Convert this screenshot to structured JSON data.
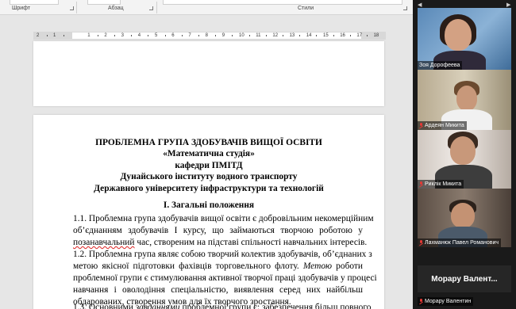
{
  "ribbon": {
    "groups": [
      {
        "label": "Шрифт"
      },
      {
        "label": "Абзац"
      },
      {
        "label": "Стили"
      }
    ]
  },
  "ruler": {
    "numbers": [
      "2",
      "1",
      "1",
      "2",
      "3",
      "4",
      "5",
      "6",
      "7",
      "8",
      "9",
      "10",
      "11",
      "12",
      "13",
      "14",
      "15",
      "16",
      "17",
      "18"
    ]
  },
  "document": {
    "title_lines": [
      "ПРОБЛЕМНА ГРУПА ЗДОБУВАЧІВ ВИЩОЇ ОСВІТИ",
      "«Математична студія»",
      "кафедри ПМІТД",
      "Дунайського інституту водного транспорту",
      "Державного університету інфраструктури та технологій"
    ],
    "section_heading": "І. Загальні положення",
    "lines": [
      "1.1. Проблемна група здобувачів вищої освіти є добровільним некомерційним",
      "об’єднанням здобувачів І курсу, що займаються творчою роботою у",
      "позанавчальний час, створеним на підставі спільності навчальних інтересів.",
      "1.2. Проблемна група являє собою творчий колектив здобувачів, об’єднаних з",
      "метою якісної підготовки фахівців торговельного флоту. Метою роботи",
      "проблемної групи є стимулювання активної творчої праці здобувачів у процесі",
      "навчання і оволодіння спеціальністю, виявлення серед них найбільш",
      "обдарованих, створення умов для їх творчого зростання.",
      "1.3. Основними завданнями проблемної групи є: забезпечення більш повного"
    ],
    "misspelled_word": "позанавчальний",
    "line2_rest": " час, створеним на підставі спільності навчальних інтересів.",
    "line5_start": "метою якісної підготовки фахівців торговельного флоту. ",
    "line5_italic": "Метою",
    "line5_end": " роботи",
    "line9_start": "1.3. Основними ",
    "line9_italic": "завданнями",
    "line9_end": " проблемної групи є: забезпечення більш повного"
  },
  "participants": [
    {
      "name": "Зоя Дорофеева",
      "muted": false
    },
    {
      "name": "Ардеян Микита",
      "muted": true
    },
    {
      "name": "Риклік Микита",
      "muted": true
    },
    {
      "name": "Лахманюк Павел Романович",
      "muted": true
    },
    {
      "name": "Морару Валентин",
      "muted": true
    }
  ],
  "name_card": "Морару Валент...",
  "colors": {
    "ribbon_bg": "#f3f3f3",
    "page_bg": "#ffffff",
    "workspace_bg": "#e6e6e6",
    "gallery_bg": "#1a1a1a",
    "muted_icon": "#e53935",
    "spellcheck": "#d22222"
  }
}
